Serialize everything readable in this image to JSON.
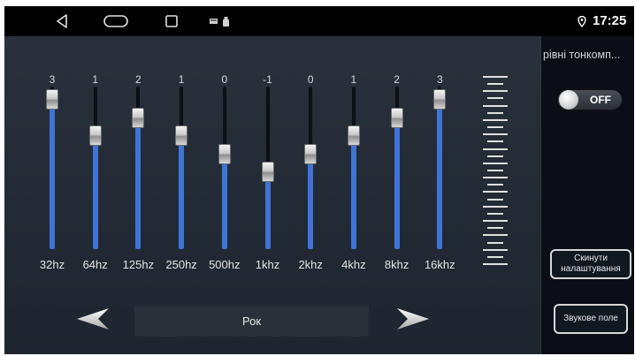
{
  "statusbar": {
    "time": "17:25"
  },
  "equalizer": {
    "bands": [
      {
        "label": "32hz",
        "value": 3
      },
      {
        "label": "64hz",
        "value": 1
      },
      {
        "label": "125hz",
        "value": 2
      },
      {
        "label": "250hz",
        "value": 1
      },
      {
        "label": "500hz",
        "value": 0
      },
      {
        "label": "1khz",
        "value": -1
      },
      {
        "label": "2khz",
        "value": 0
      },
      {
        "label": "4khz",
        "value": 1
      },
      {
        "label": "8khz",
        "value": 2
      },
      {
        "label": "16khz",
        "value": 3
      }
    ],
    "value_range": [
      -5,
      3
    ],
    "preset": "Рок"
  },
  "panel": {
    "title": "рівні тонкомп...",
    "loudness_toggle": {
      "label": "OFF",
      "on": false
    },
    "reset_button": "Скинути налаштування",
    "sound_field_button": "Звукове поле"
  },
  "colors": {
    "fill": "#3f74d6",
    "background": "#1c2430",
    "statusbar": "#000000"
  }
}
